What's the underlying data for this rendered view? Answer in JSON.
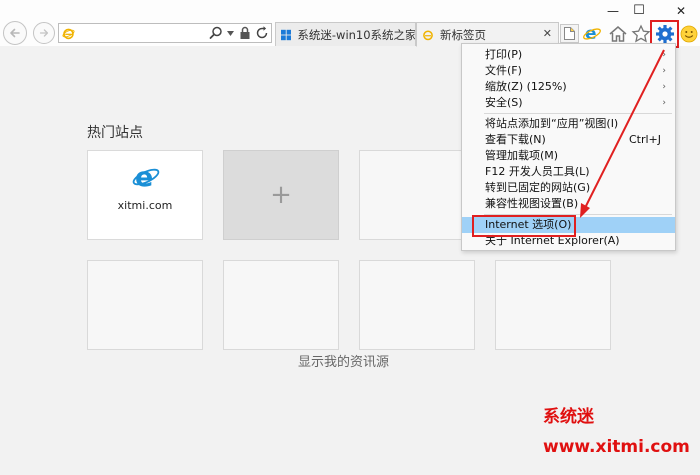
{
  "window": {
    "minimize_symbol": "—",
    "maximize_symbol": "☐",
    "close_symbol": "✕"
  },
  "address_bar": {
    "value": "",
    "placeholder": "",
    "search_icon": "magnifier-icon",
    "dropdown_icon": "chevron-down-icon",
    "lock_icon": "lock-icon",
    "refresh_icon": "refresh-icon"
  },
  "tabs": [
    {
      "label": "系统迷-win10系统之家_...",
      "icon": "windows-logo-icon",
      "active": false
    },
    {
      "label": "新标签页",
      "icon": "ie-logo-icon",
      "active": true,
      "close_symbol": "✕"
    }
  ],
  "toolbar": {
    "home_icon": "home-icon",
    "favorites_icon": "star-icon",
    "tools_icon": "gear-icon",
    "feedback_icon": "smiley-icon"
  },
  "new_tab_page": {
    "section_title": "热门站点",
    "tiles": [
      {
        "label": "xitmi.com",
        "icon": "ie-logo-icon"
      },
      {
        "label": "+",
        "kind": "add"
      },
      {
        "label": ""
      },
      {
        "label": ""
      },
      {
        "label": ""
      },
      {
        "label": ""
      },
      {
        "label": ""
      },
      {
        "label": ""
      }
    ],
    "feed_link": "显示我的资讯源"
  },
  "tools_menu": {
    "items": [
      {
        "label": "打印(P)",
        "submenu": true
      },
      {
        "label": "文件(F)",
        "submenu": true
      },
      {
        "label": "缩放(Z) (125%)",
        "submenu": true
      },
      {
        "label": "安全(S)",
        "submenu": true
      },
      {
        "label": "将站点添加到“应用”视图(I)"
      },
      {
        "label": "查看下载(N)",
        "shortcut": "Ctrl+J"
      },
      {
        "label": "管理加载项(M)"
      },
      {
        "label": "F12 开发人员工具(L)"
      },
      {
        "label": "转到已固定的网站(G)"
      },
      {
        "label": "兼容性视图设置(B)"
      },
      {
        "label": "Internet 选项(O)",
        "highlighted": true
      },
      {
        "label": "关于 Internet Explorer(A)"
      }
    ],
    "submenu_arrow": "›"
  },
  "watermark": {
    "name": "系统迷",
    "url": "www.xitmi.com"
  },
  "colors": {
    "highlight": "#9fd1f7",
    "annotation_red": "#e02020",
    "ie_blue": "#1a8fd6",
    "gear_blue": "#1f6fd0"
  }
}
